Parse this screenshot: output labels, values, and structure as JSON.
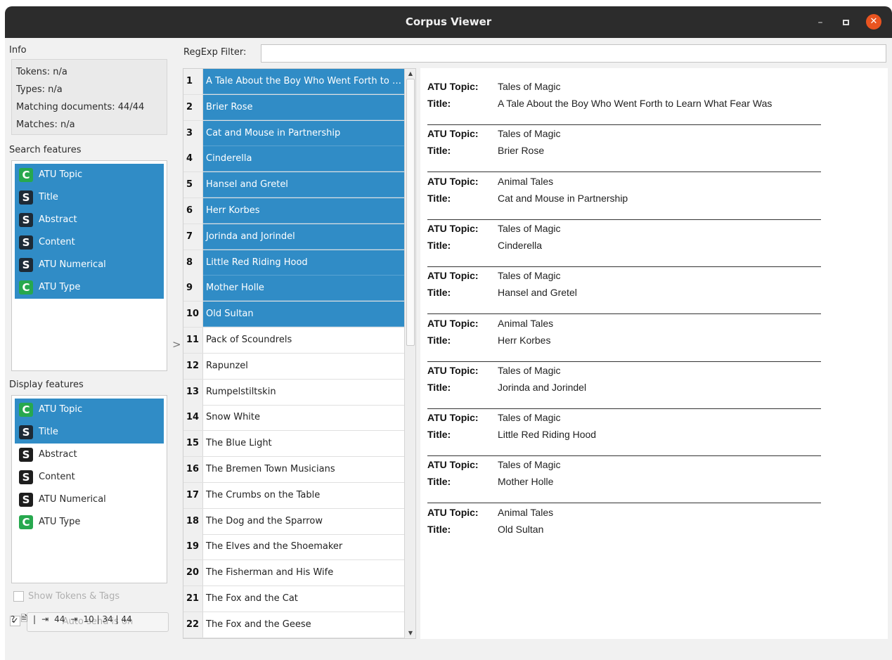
{
  "window": {
    "title": "Corpus Viewer",
    "minimize": "–",
    "close": "✕"
  },
  "info": {
    "label": "Info",
    "tokens": "Tokens: n/a",
    "types": "Types: n/a",
    "matching": "Matching documents: 44/44",
    "matches": "Matches: n/a"
  },
  "search_features": {
    "label": "Search features",
    "items": [
      {
        "type": "C",
        "label": "ATU Topic",
        "selected": true
      },
      {
        "type": "S",
        "label": "Title",
        "selected": true
      },
      {
        "type": "S",
        "label": "Abstract",
        "selected": true
      },
      {
        "type": "S",
        "label": "Content",
        "selected": true
      },
      {
        "type": "S",
        "label": "ATU Numerical",
        "selected": true
      },
      {
        "type": "C",
        "label": "ATU Type",
        "selected": true
      }
    ]
  },
  "display_features": {
    "label": "Display features",
    "items": [
      {
        "type": "C",
        "label": "ATU Topic",
        "selected": true
      },
      {
        "type": "S",
        "label": "Title",
        "selected": true
      },
      {
        "type": "S",
        "label": "Abstract",
        "selected": false
      },
      {
        "type": "S",
        "label": "Content",
        "selected": false
      },
      {
        "type": "S",
        "label": "ATU Numerical",
        "selected": false
      },
      {
        "type": "C",
        "label": "ATU Type",
        "selected": false
      }
    ]
  },
  "show_tokens": {
    "label": "Show Tokens & Tags",
    "checked": false
  },
  "auto_send": {
    "label": "Auto send is on",
    "checked": true,
    "check_glyph": "✓"
  },
  "status": {
    "help": "?",
    "doc": "🗎",
    "sep": "|",
    "input_count": "44",
    "output_count": "10 | 34 | 44",
    "in_icon": "⇥",
    "out_icon": "⇥"
  },
  "filter": {
    "label": "RegExp Filter:",
    "value": "",
    "placeholder": ""
  },
  "doc_list": {
    "current_marker": ">",
    "scroll_up": "▲",
    "scroll_down": "▼",
    "rows": [
      {
        "num": "1",
        "title": "A Tale About the Boy Who Went Forth to Learn What Fear Was",
        "selected": true
      },
      {
        "num": "2",
        "title": "Brier Rose",
        "selected": true
      },
      {
        "num": "3",
        "title": "Cat and Mouse in Partnership",
        "selected": true
      },
      {
        "num": "4",
        "title": "Cinderella",
        "selected": true
      },
      {
        "num": "5",
        "title": "Hansel and Gretel",
        "selected": true
      },
      {
        "num": "6",
        "title": "Herr Korbes",
        "selected": true
      },
      {
        "num": "7",
        "title": "Jorinda and Jorindel",
        "selected": true
      },
      {
        "num": "8",
        "title": "Little Red Riding Hood",
        "selected": true
      },
      {
        "num": "9",
        "title": "Mother Holle",
        "selected": true
      },
      {
        "num": "10",
        "title": "Old Sultan",
        "selected": true
      },
      {
        "num": "11",
        "title": "Pack of Scoundrels",
        "selected": false
      },
      {
        "num": "12",
        "title": "Rapunzel",
        "selected": false
      },
      {
        "num": "13",
        "title": "Rumpelstiltskin",
        "selected": false
      },
      {
        "num": "14",
        "title": "Snow White",
        "selected": false
      },
      {
        "num": "15",
        "title": "The Blue Light",
        "selected": false
      },
      {
        "num": "16",
        "title": "The Bremen Town Musicians",
        "selected": false
      },
      {
        "num": "17",
        "title": "The Crumbs on the Table",
        "selected": false
      },
      {
        "num": "18",
        "title": "The Dog and the Sparrow",
        "selected": false
      },
      {
        "num": "19",
        "title": "The Elves and the Shoemaker",
        "selected": false
      },
      {
        "num": "20",
        "title": "The Fisherman and His Wife",
        "selected": false
      },
      {
        "num": "21",
        "title": "The Fox and the Cat",
        "selected": false
      },
      {
        "num": "22",
        "title": "The Fox and the Geese",
        "selected": false
      }
    ]
  },
  "detail": {
    "topic_key": "ATU Topic:",
    "title_key": "Title:",
    "records": [
      {
        "topic": "Tales of Magic",
        "title": "A Tale About the Boy Who Went Forth to Learn What Fear Was"
      },
      {
        "topic": "Tales of Magic",
        "title": "Brier Rose"
      },
      {
        "topic": "Animal Tales",
        "title": "Cat and Mouse in Partnership"
      },
      {
        "topic": "Tales of Magic",
        "title": "Cinderella"
      },
      {
        "topic": "Tales of Magic",
        "title": "Hansel and Gretel"
      },
      {
        "topic": "Animal Tales",
        "title": "Herr Korbes"
      },
      {
        "topic": "Tales of Magic",
        "title": "Jorinda and Jorindel"
      },
      {
        "topic": "Tales of Magic",
        "title": "Little Red Riding Hood"
      },
      {
        "topic": "Tales of Magic",
        "title": "Mother Holle"
      },
      {
        "topic": "Animal Tales",
        "title": "Old Sultan"
      }
    ]
  },
  "colors": {
    "selection": "#308cc6",
    "continuous_badge": "#27a84e",
    "string_badge": "#1e1e1e",
    "close_button": "#e95420"
  }
}
